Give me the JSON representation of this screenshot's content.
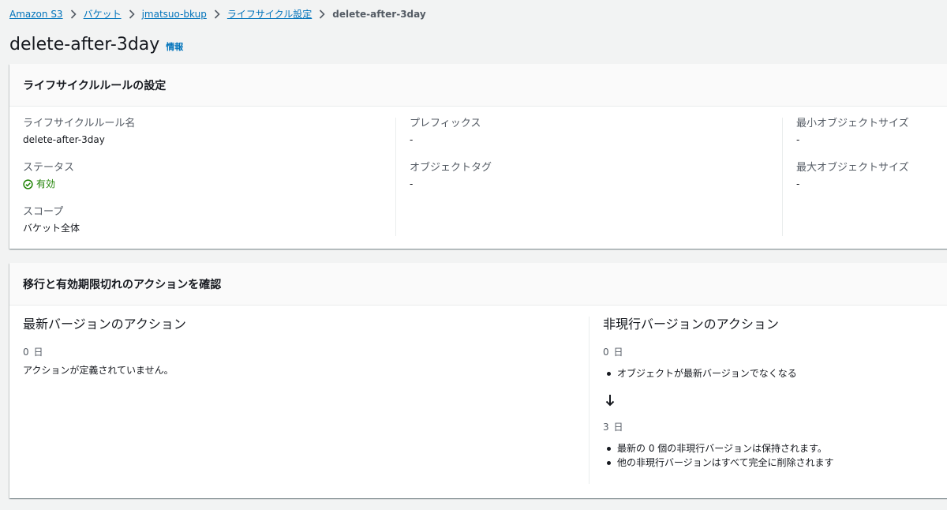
{
  "breadcrumb": {
    "items": [
      "Amazon S3",
      "バケット",
      "jmatsuo-bkup",
      "ライフサイクル設定"
    ],
    "current": "delete-after-3day"
  },
  "page": {
    "title": "delete-after-3day",
    "info": "情報"
  },
  "rule_config": {
    "header": "ライフサイクルルールの設定",
    "name_label": "ライフサイクルルール名",
    "name_value": "delete-after-3day",
    "status_label": "ステータス",
    "status_value": "有効",
    "status_color": "#1d8102",
    "scope_label": "スコープ",
    "scope_value": "バケット全体",
    "prefix_label": "プレフィックス",
    "prefix_value": "-",
    "tag_label": "オブジェクトタグ",
    "tag_value": "-",
    "min_size_label": "最小オブジェクトサイズ",
    "min_size_value": "-",
    "max_size_label": "最大オブジェクトサイズ",
    "max_size_value": "-"
  },
  "actions": {
    "header": "移行と有効期限切れのアクションを確認",
    "current": {
      "title": "最新バージョンのアクション",
      "day": "0 日",
      "text": "アクションが定義されていません。"
    },
    "noncurrent": {
      "title": "非現行バージョンのアクション",
      "day0": "0 日",
      "day0_items": [
        "オブジェクトが最新バージョンでなくなる"
      ],
      "day3": "3 日",
      "day3_items": [
        "最新の 0 個の非現行バージョンは保持されます。",
        "他の非現行バージョンはすべて完全に削除されます"
      ]
    }
  },
  "icons": {
    "separator": "chevron-right-icon",
    "status": "check-circle-icon",
    "arrow": "arrow-down-icon"
  }
}
